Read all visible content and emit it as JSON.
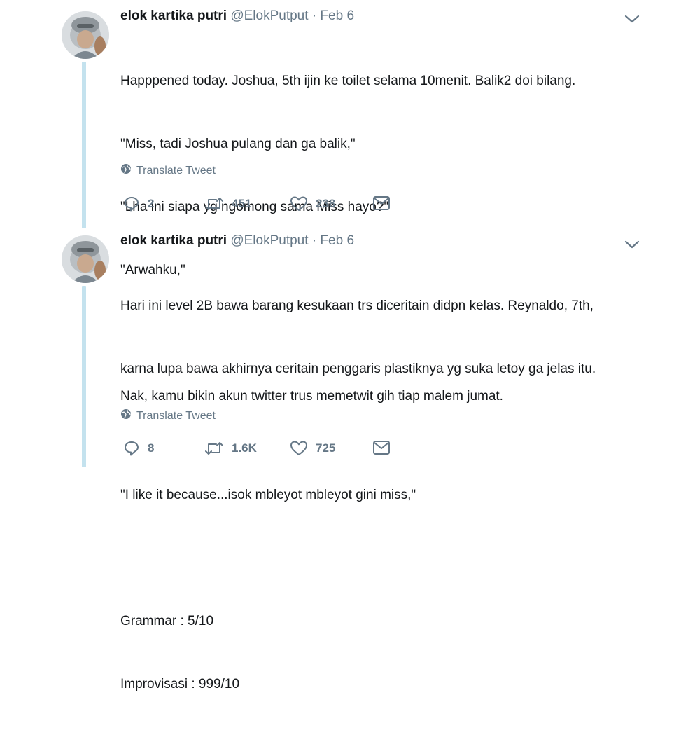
{
  "tweets": [
    {
      "author_name": "elok kartika putri",
      "handle": "@ElokPutput",
      "separator": "·",
      "date": "Feb 6",
      "lines": [
        "Happpened today. Joshua, 5th ijin ke toilet selama 10menit. Balik2 doi bilang.",
        "\"Miss, tadi Joshua pulang dan ga balik,\"",
        "\"Lha ini siapa yg ngomong sama Miss hayo?\"",
        "\"Arwahku,\"",
        "",
        "Nak, kamu bikin akun twitter trus memetwit gih tiap malem jumat."
      ],
      "translate_label": "Translate Tweet",
      "reply_count": "2",
      "retweet_count": "451",
      "like_count": "238"
    },
    {
      "author_name": "elok kartika putri",
      "handle": "@ElokPutput",
      "separator": "·",
      "date": "Feb 6",
      "lines": [
        "Hari ini level 2B bawa barang kesukaan trs diceritain didpn kelas. Reynaldo, 7th,",
        "karna lupa bawa akhirnya ceritain penggaris plastiknya yg suka letoy ga jelas itu.",
        "",
        "\"I like it because...isok mbleyot mbleyot gini miss,\"",
        "",
        "Grammar : 5/10",
        "Improvisasi : 999/10"
      ],
      "translate_label": "Translate Tweet",
      "reply_count": "8",
      "retweet_count": "1.6K",
      "like_count": "725"
    }
  ],
  "icons": {
    "reply": "reply-icon",
    "retweet": "retweet-icon",
    "like": "heart-icon",
    "dm": "envelope-icon",
    "translate": "globe-icon",
    "caret": "chevron-down-icon"
  },
  "colors": {
    "text": "#14171a",
    "secondary": "#657786",
    "thread_line": "#c4e2ee",
    "background": "#ffffff"
  }
}
